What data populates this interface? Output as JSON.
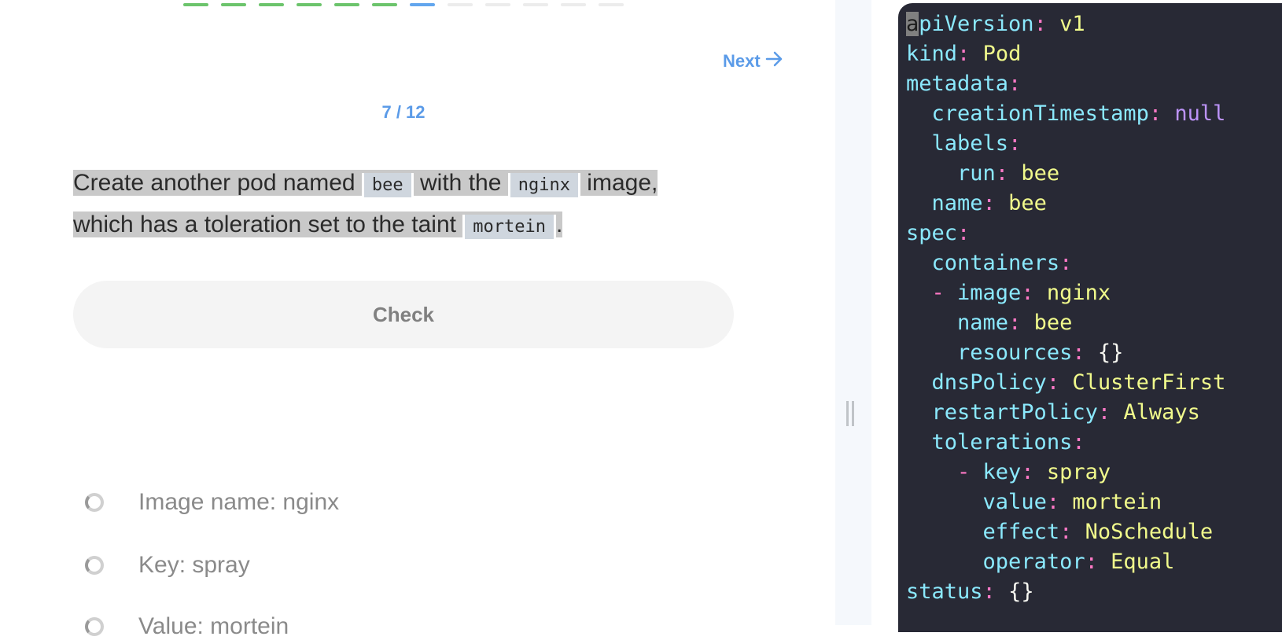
{
  "progress": {
    "segment_states": [
      "done",
      "done",
      "done",
      "done",
      "done",
      "done",
      "current",
      "todo",
      "todo",
      "todo",
      "todo",
      "todo"
    ],
    "colors": {
      "done": "#6cc46c",
      "current": "#62a6ee",
      "todo": "#ececec"
    }
  },
  "nav": {
    "next_label": "Next",
    "next_icon": "arrow-right-icon"
  },
  "counter": "7 / 12",
  "question": {
    "p1": "Create another pod named ",
    "c1": "bee",
    "p2": " with the ",
    "c2": "nginx",
    "p3": " image,",
    "p4": "which has a toleration set to the taint ",
    "c3": "mortein",
    "p5": "."
  },
  "check_label": "Check",
  "tasks": [
    {
      "label": "Image name: nginx"
    },
    {
      "label": "Key: spray"
    },
    {
      "label": "Value: mortein"
    }
  ],
  "editor": {
    "lines": [
      {
        "indent": "",
        "dash": "",
        "key": "apiVersion",
        "value": "v1",
        "vtype": "v"
      },
      {
        "indent": "",
        "dash": "",
        "key": "kind",
        "value": "Pod",
        "vtype": "v"
      },
      {
        "indent": "",
        "dash": "",
        "key": "metadata",
        "value": "",
        "vtype": "v"
      },
      {
        "indent": "  ",
        "dash": "",
        "key": "creationTimestamp",
        "value": "null",
        "vtype": "n"
      },
      {
        "indent": "  ",
        "dash": "",
        "key": "labels",
        "value": "",
        "vtype": "v"
      },
      {
        "indent": "    ",
        "dash": "",
        "key": "run",
        "value": "bee",
        "vtype": "v"
      },
      {
        "indent": "  ",
        "dash": "",
        "key": "name",
        "value": "bee",
        "vtype": "v"
      },
      {
        "indent": "",
        "dash": "",
        "key": "spec",
        "value": "",
        "vtype": "v"
      },
      {
        "indent": "  ",
        "dash": "",
        "key": "containers",
        "value": "",
        "vtype": "v"
      },
      {
        "indent": "  ",
        "dash": "- ",
        "key": "image",
        "value": "nginx",
        "vtype": "v"
      },
      {
        "indent": "    ",
        "dash": "",
        "key": "name",
        "value": "bee",
        "vtype": "v"
      },
      {
        "indent": "    ",
        "dash": "",
        "key": "resources",
        "value": "{}",
        "vtype": "w"
      },
      {
        "indent": "  ",
        "dash": "",
        "key": "dnsPolicy",
        "value": "ClusterFirst",
        "vtype": "v"
      },
      {
        "indent": "  ",
        "dash": "",
        "key": "restartPolicy",
        "value": "Always",
        "vtype": "v"
      },
      {
        "indent": "  ",
        "dash": "",
        "key": "tolerations",
        "value": "",
        "vtype": "v"
      },
      {
        "indent": "    ",
        "dash": "- ",
        "key": "key",
        "value": "spray",
        "vtype": "v"
      },
      {
        "indent": "      ",
        "dash": "",
        "key": "value",
        "value": "mortein",
        "vtype": "v"
      },
      {
        "indent": "      ",
        "dash": "",
        "key": "effect",
        "value": "NoSchedule",
        "vtype": "v"
      },
      {
        "indent": "      ",
        "dash": "",
        "key": "operator",
        "value": "Equal",
        "vtype": "v"
      },
      {
        "indent": "",
        "dash": "",
        "key": "status",
        "value": "{}",
        "vtype": "w"
      }
    ]
  }
}
